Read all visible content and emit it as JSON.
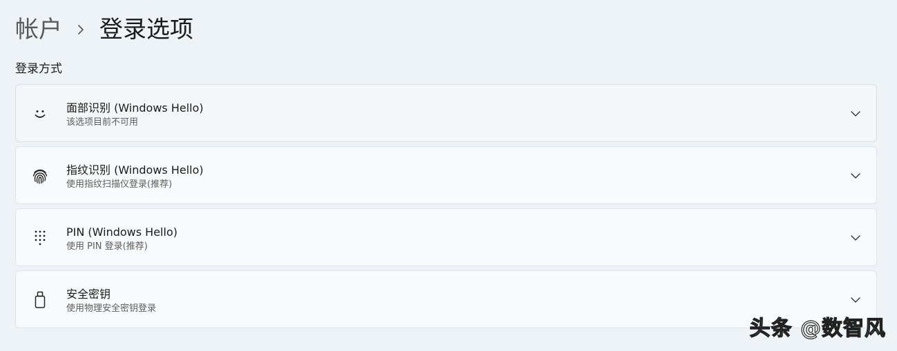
{
  "breadcrumb": {
    "parent": "帐户",
    "separator_icon": "chevron-right-icon",
    "current": "登录选项"
  },
  "section": {
    "heading": "登录方式"
  },
  "options": [
    {
      "icon": "face-smile-icon",
      "title": "面部识别 (Windows Hello)",
      "subtitle": "该选项目前不可用"
    },
    {
      "icon": "fingerprint-icon",
      "title": "指纹识别 (Windows Hello)",
      "subtitle": "使用指纹扫描仪登录(推荐)"
    },
    {
      "icon": "pin-keypad-icon",
      "title": "PIN (Windows Hello)",
      "subtitle": "使用 PIN 登录(推荐)"
    },
    {
      "icon": "security-key-icon",
      "title": "安全密钥",
      "subtitle": "使用物理安全密钥登录"
    }
  ],
  "watermark": "头条 @数智风",
  "colors": {
    "background": "#eef3f7",
    "card": "#f8fbfd",
    "card_border": "#e1e5e8",
    "text_primary": "#1a1a1a",
    "text_secondary": "#5d5d5d"
  }
}
